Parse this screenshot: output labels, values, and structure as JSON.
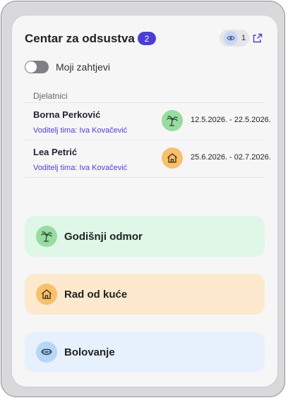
{
  "header": {
    "title": "Centar za odsustva",
    "pending_count": "2",
    "viewer_count": "1"
  },
  "filter": {
    "label": "Moji zahtjevi",
    "enabled": false
  },
  "table": {
    "column_label": "Djelatnici",
    "rows": [
      {
        "name": "Borna Perković",
        "lead": "Voditelj tima: Iva Kovačević",
        "type_icon": "palm-tree-icon",
        "dates": "12.5.2026. - 22.5.2026."
      },
      {
        "name": "Lea Petrić",
        "lead": "Voditelj tima: Iva Kovačević",
        "type_icon": "house-icon",
        "dates": "25.6.2026. - 02.7.2026."
      }
    ]
  },
  "absence_types": [
    {
      "label": "Godišnji odmor",
      "icon": "palm-tree-icon",
      "color": "#98dc9f"
    },
    {
      "label": "Rad od kuće",
      "icon": "house-icon",
      "color": "#f7c06c"
    },
    {
      "label": "Bolovanje",
      "icon": "face-mask-icon",
      "color": "#b7d6f6"
    }
  ],
  "colors": {
    "accent": "#4a3fd1",
    "link": "#4b3fd6"
  }
}
